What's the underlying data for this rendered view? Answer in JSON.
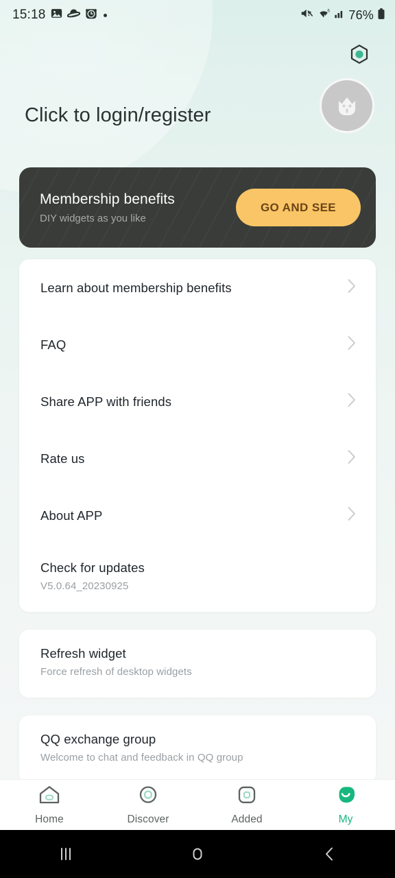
{
  "statusbar": {
    "time": "15:18",
    "battery_percent": "76%",
    "left_icons": [
      "photo-icon",
      "saturn-icon",
      "alarm-icon",
      "dot-indicator"
    ],
    "right_icons": [
      "mute-icon",
      "wifi-icon",
      "cellular-signal-icon",
      "battery-icon"
    ]
  },
  "header": {
    "login_text": "Click to login/register",
    "settings_icon": "hexagon-settings-icon",
    "avatar_icon": "cat-avatar-icon"
  },
  "banner": {
    "title": "Membership benefits",
    "subtitle": "DIY widgets as you like",
    "cta_label": "GO AND SEE"
  },
  "menu_card": [
    {
      "label": "Learn about membership benefits",
      "chevron": true
    },
    {
      "label": "FAQ",
      "chevron": true
    },
    {
      "label": "Share APP with friends",
      "chevron": true
    },
    {
      "label": "Rate us",
      "chevron": true
    },
    {
      "label": "About APP",
      "chevron": true
    },
    {
      "label": "Check for updates",
      "sub": "V5.0.64_20230925",
      "chevron": false
    }
  ],
  "refresh_card": {
    "label": "Refresh widget",
    "sub": "Force refresh of desktop widgets"
  },
  "qq_card": {
    "label": "QQ exchange group",
    "sub": "Welcome to chat and feedback in QQ group"
  },
  "tabs": [
    {
      "label": "Home",
      "icon": "home-icon",
      "active": false
    },
    {
      "label": "Discover",
      "icon": "compass-icon",
      "active": false
    },
    {
      "label": "Added",
      "icon": "square-icon",
      "active": false
    },
    {
      "label": "My",
      "icon": "profile-leaf-icon",
      "active": true
    }
  ],
  "navbar": {
    "recents": "recents-icon",
    "home": "home-nav-icon",
    "back": "back-icon"
  },
  "colors": {
    "accent_green": "#17b77f",
    "banner_bg": "#393c39",
    "cta_bg": "#f9c566",
    "cta_text": "#6b4417",
    "page_bg": "#e9f3f0"
  }
}
